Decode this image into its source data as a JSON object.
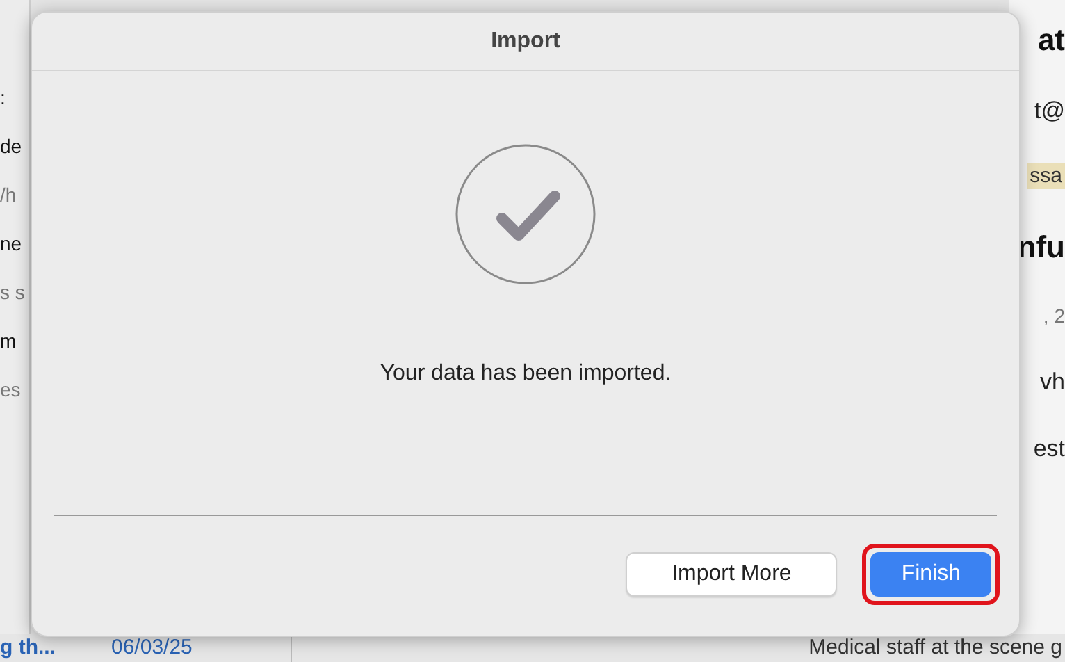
{
  "background": {
    "sidebar_fragments": [
      {
        "kind": "title",
        "text": ":"
      },
      {
        "kind": "title",
        "text": "de"
      },
      {
        "kind": "sub",
        "text": "/h"
      },
      {
        "kind": "title",
        "text": "ne"
      },
      {
        "kind": "sub",
        "text": "s s"
      },
      {
        "kind": "title",
        "text": "m"
      },
      {
        "kind": "sub",
        "text": "es"
      }
    ],
    "detail_fragments": [
      {
        "kind": "heading",
        "text": "at"
      },
      {
        "kind": "line",
        "text": "t@"
      },
      {
        "kind": "tag",
        "text": "ssa"
      },
      {
        "kind": "heading",
        "text": "nfu"
      },
      {
        "kind": "sub",
        "text": ", 2"
      },
      {
        "kind": "line",
        "text": "vh"
      },
      {
        "kind": "line",
        "text": "est"
      }
    ],
    "bottom_row": {
      "subject": "g th...",
      "date": "06/03/25",
      "body": "Medical staff at the scene g"
    }
  },
  "dialog": {
    "title": "Import",
    "message": "Your data has been imported.",
    "buttons": [
      {
        "label": "Import More",
        "kind": "secondary",
        "highlighted": false
      },
      {
        "label": "Finish",
        "kind": "primary",
        "highlighted": true
      }
    ]
  }
}
